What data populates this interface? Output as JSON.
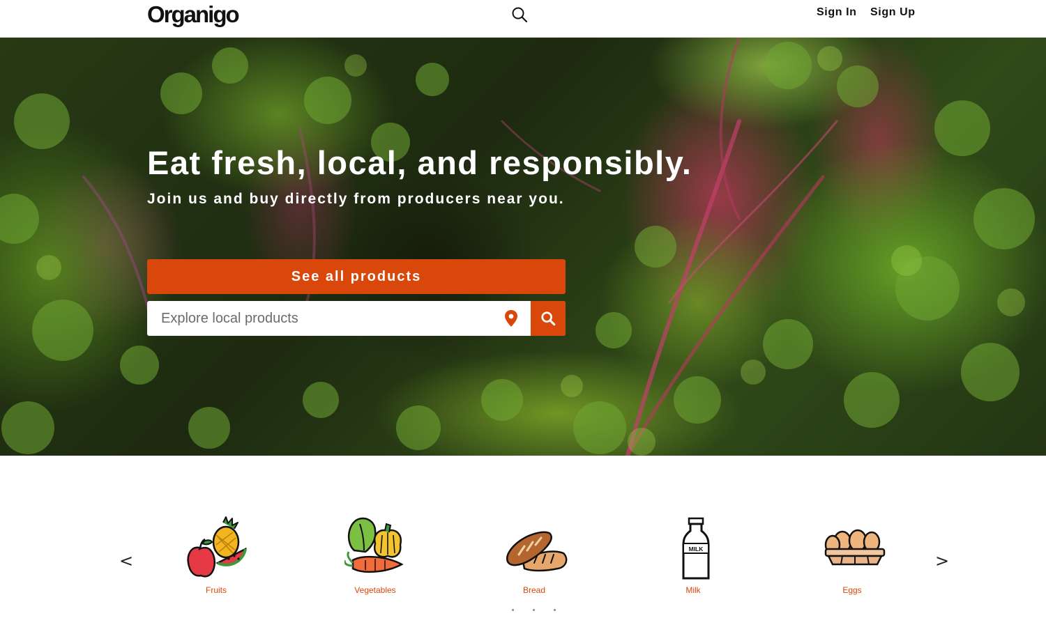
{
  "header": {
    "logo": "Organigo",
    "search_icon": "search-icon",
    "nav": [
      {
        "label": "Sign In"
      },
      {
        "label": "Sign Up"
      }
    ]
  },
  "hero": {
    "background": "kale-leaves-photo",
    "title": "Eat fresh, local, and responsibly.",
    "subtitle": "Join us and buy directly from producers near you.",
    "cta_label": "See all products",
    "search": {
      "placeholder": "Explore local products",
      "location_icon": "map-pin-icon",
      "submit_icon": "search-icon"
    }
  },
  "categories": {
    "prev_label": "<",
    "next_label": ">",
    "items": [
      {
        "label": "Fruits",
        "icon": "fruits-icon"
      },
      {
        "label": "Vegetables",
        "icon": "vegetables-icon"
      },
      {
        "label": "Bread",
        "icon": "bread-icon"
      },
      {
        "label": "Milk",
        "icon": "milk-icon"
      },
      {
        "label": "Eggs",
        "icon": "eggs-icon"
      }
    ],
    "milk_bottle_text": "MILK"
  },
  "colors": {
    "accent": "#d9480a",
    "header_bg": "#ffffff",
    "hero_text": "#ffffff"
  }
}
